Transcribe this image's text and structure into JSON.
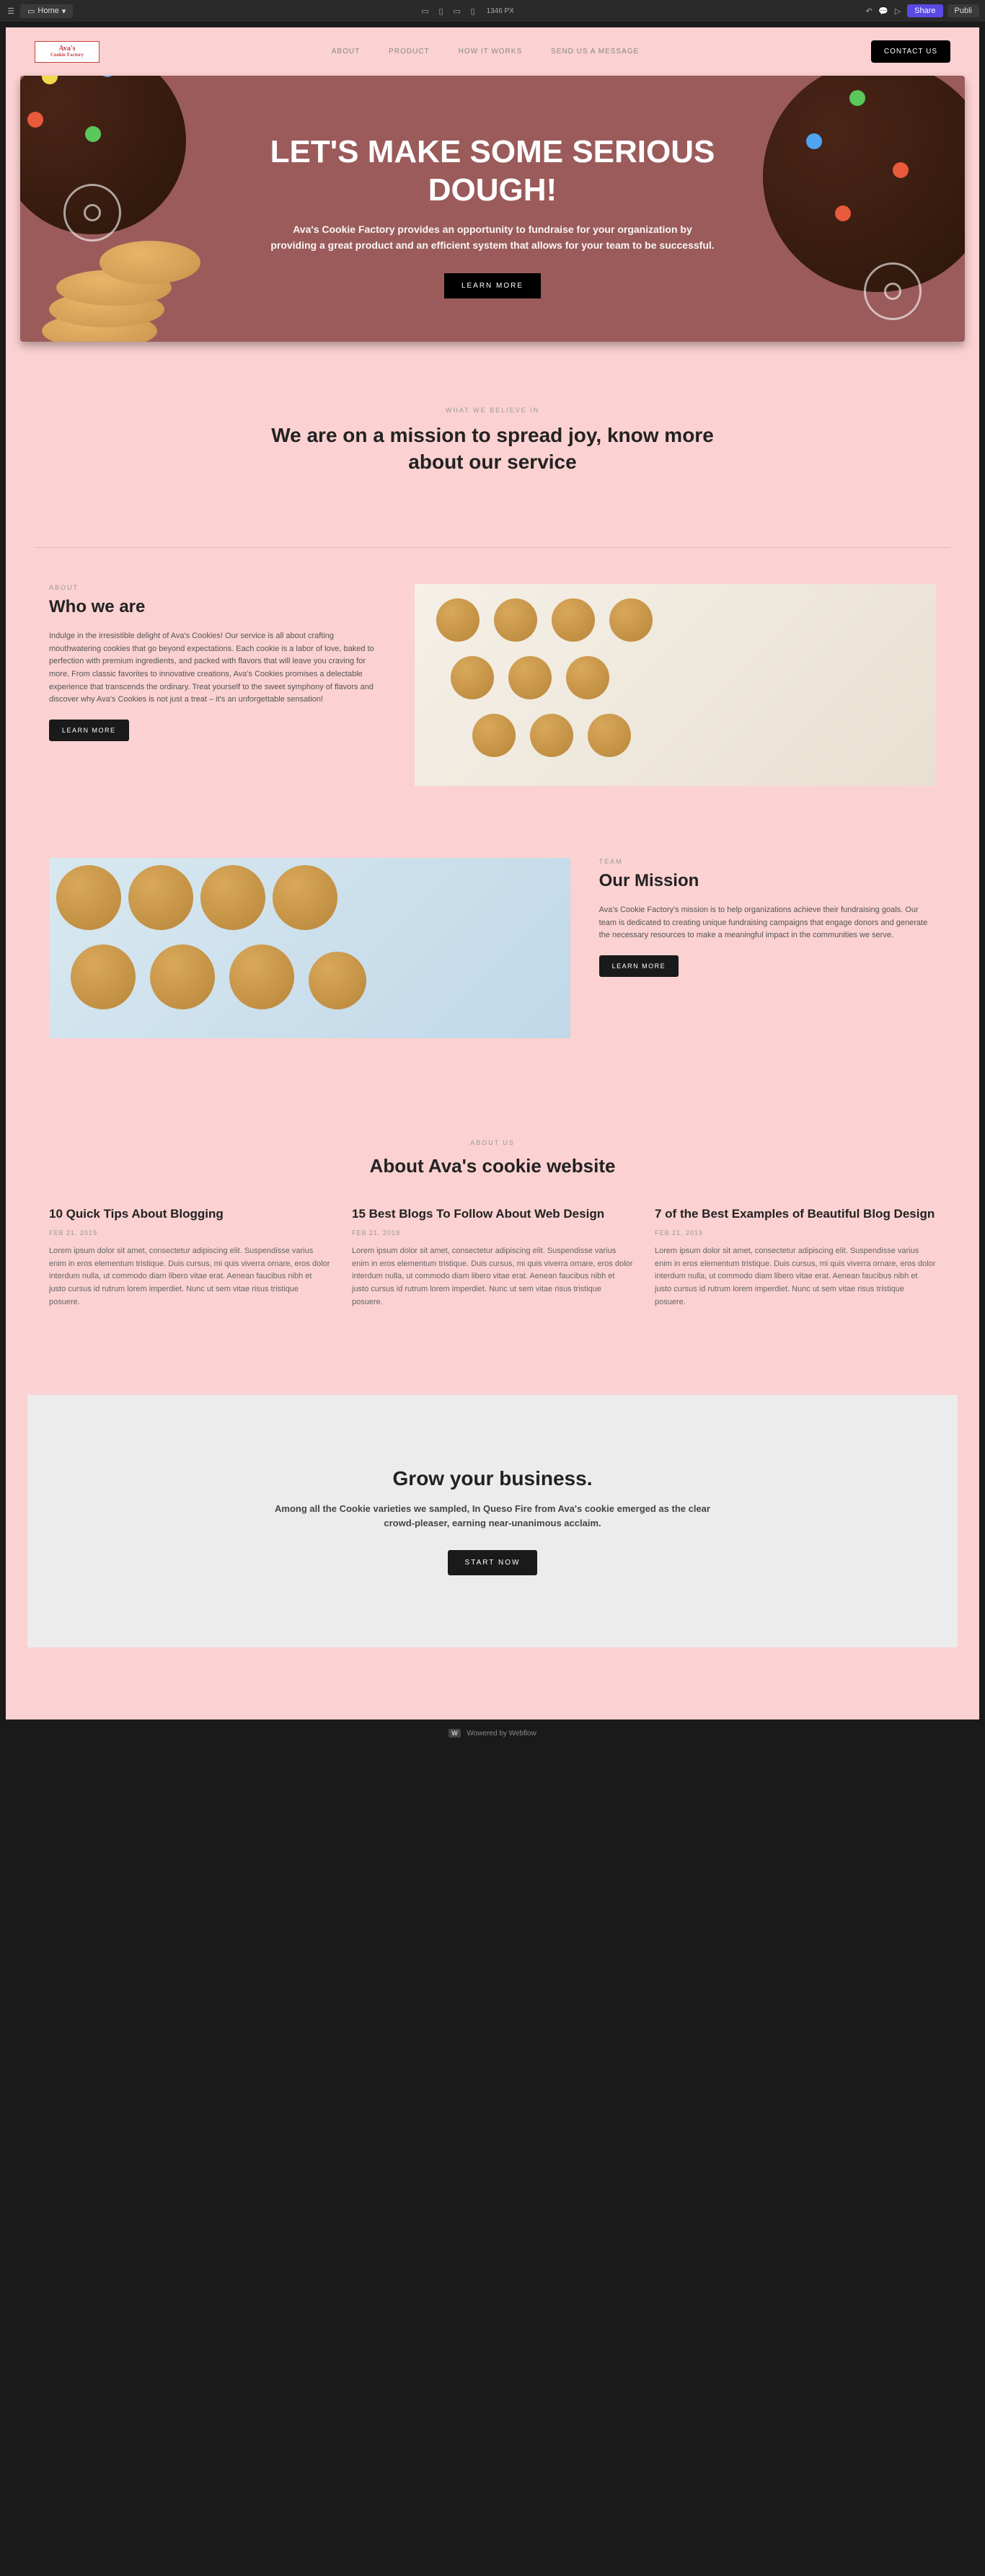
{
  "toolbar": {
    "home": "Home",
    "viewport_width": "1346 PX",
    "share": "Share",
    "publish": "Publi"
  },
  "header": {
    "logo_line1": "Ava's",
    "logo_line2": "Cookie Factory",
    "nav": [
      "ABOUT",
      "PRODUCT",
      "HOW IT WORKS",
      "SEND US A MESSAGE"
    ],
    "contact": "CONTACT US"
  },
  "hero": {
    "title": "LET'S MAKE SOME SERIOUS DOUGH!",
    "subtitle": "Ava's Cookie Factory provides an opportunity to fundraise for your organization by providing a great product and an efficient system that allows for your team to be successful.",
    "button": "LEARN MORE"
  },
  "mission_intro": {
    "eyebrow": "WHAT WE BELIEVE IN",
    "heading": "We are on a mission to spread joy, know more about our service"
  },
  "who": {
    "label": "ABOUT",
    "heading": "Who we are",
    "body": "Indulge in the irresistible delight of Ava's Cookies! Our service is all about crafting mouthwatering cookies that go beyond expectations. Each cookie is a labor of love, baked to perfection with premium ingredients, and packed with flavors that will leave you craving for more. From classic favorites to innovative creations, Ava's Cookies promises a delectable experience that transcends the ordinary. Treat yourself to the sweet symphony of flavors and discover why Ava's Cookies is not just a treat – it's an unforgettable sensation!",
    "button": "LEARN MORE"
  },
  "mission": {
    "label": "TEAM",
    "heading": "Our Mission",
    "body": "Ava's Cookie Factory's mission is to help organizations achieve their fundraising goals. Our team is dedicated to creating unique fundraising campaigns that engage donors and generate the necessary resources to make a meaningful impact in the communities we serve.",
    "button": "LEARN MORE"
  },
  "about": {
    "eyebrow": "ABOUT US",
    "heading": "About Ava's cookie website",
    "articles": [
      {
        "title": "10 Quick Tips About Blogging",
        "date": "FEB 21, 2019",
        "excerpt": "Lorem ipsum dolor sit amet, consectetur adipiscing elit. Suspendisse varius enim in eros elementum tristique. Duis cursus, mi quis viverra ornare, eros dolor interdum nulla, ut commodo diam libero vitae erat. Aenean faucibus nibh et justo cursus id rutrum lorem imperdiet. Nunc ut sem vitae risus tristique posuere."
      },
      {
        "title": "15 Best Blogs To Follow About Web Design",
        "date": "FEB 21, 2019",
        "excerpt": "Lorem ipsum dolor sit amet, consectetur adipiscing elit. Suspendisse varius enim in eros elementum tristique. Duis cursus, mi quis viverra ornare, eros dolor interdum nulla, ut commodo diam libero vitae erat. Aenean faucibus nibh et justo cursus id rutrum lorem imperdiet. Nunc ut sem vitae risus tristique posuere."
      },
      {
        "title": "7 of the Best Examples of Beautiful Blog Design",
        "date": "FEB 21, 2019",
        "excerpt": "Lorem ipsum dolor sit amet, consectetur adipiscing elit. Suspendisse varius enim in eros elementum tristique. Duis cursus, mi quis viverra ornare, eros dolor interdum nulla, ut commodo diam libero vitae erat. Aenean faucibus nibh et justo cursus id rutrum lorem imperdiet. Nunc ut sem vitae risus tristique posuere."
      }
    ]
  },
  "cta": {
    "heading": "Grow your business.",
    "body": "Among all the Cookie varieties we sampled, In Queso Fire from Ava's cookie emerged as the clear crowd-pleaser, earning near-unanimous acclaim.",
    "button": "START NOW"
  },
  "footer": {
    "w": "W",
    "text": "Wowered by Webflow"
  }
}
